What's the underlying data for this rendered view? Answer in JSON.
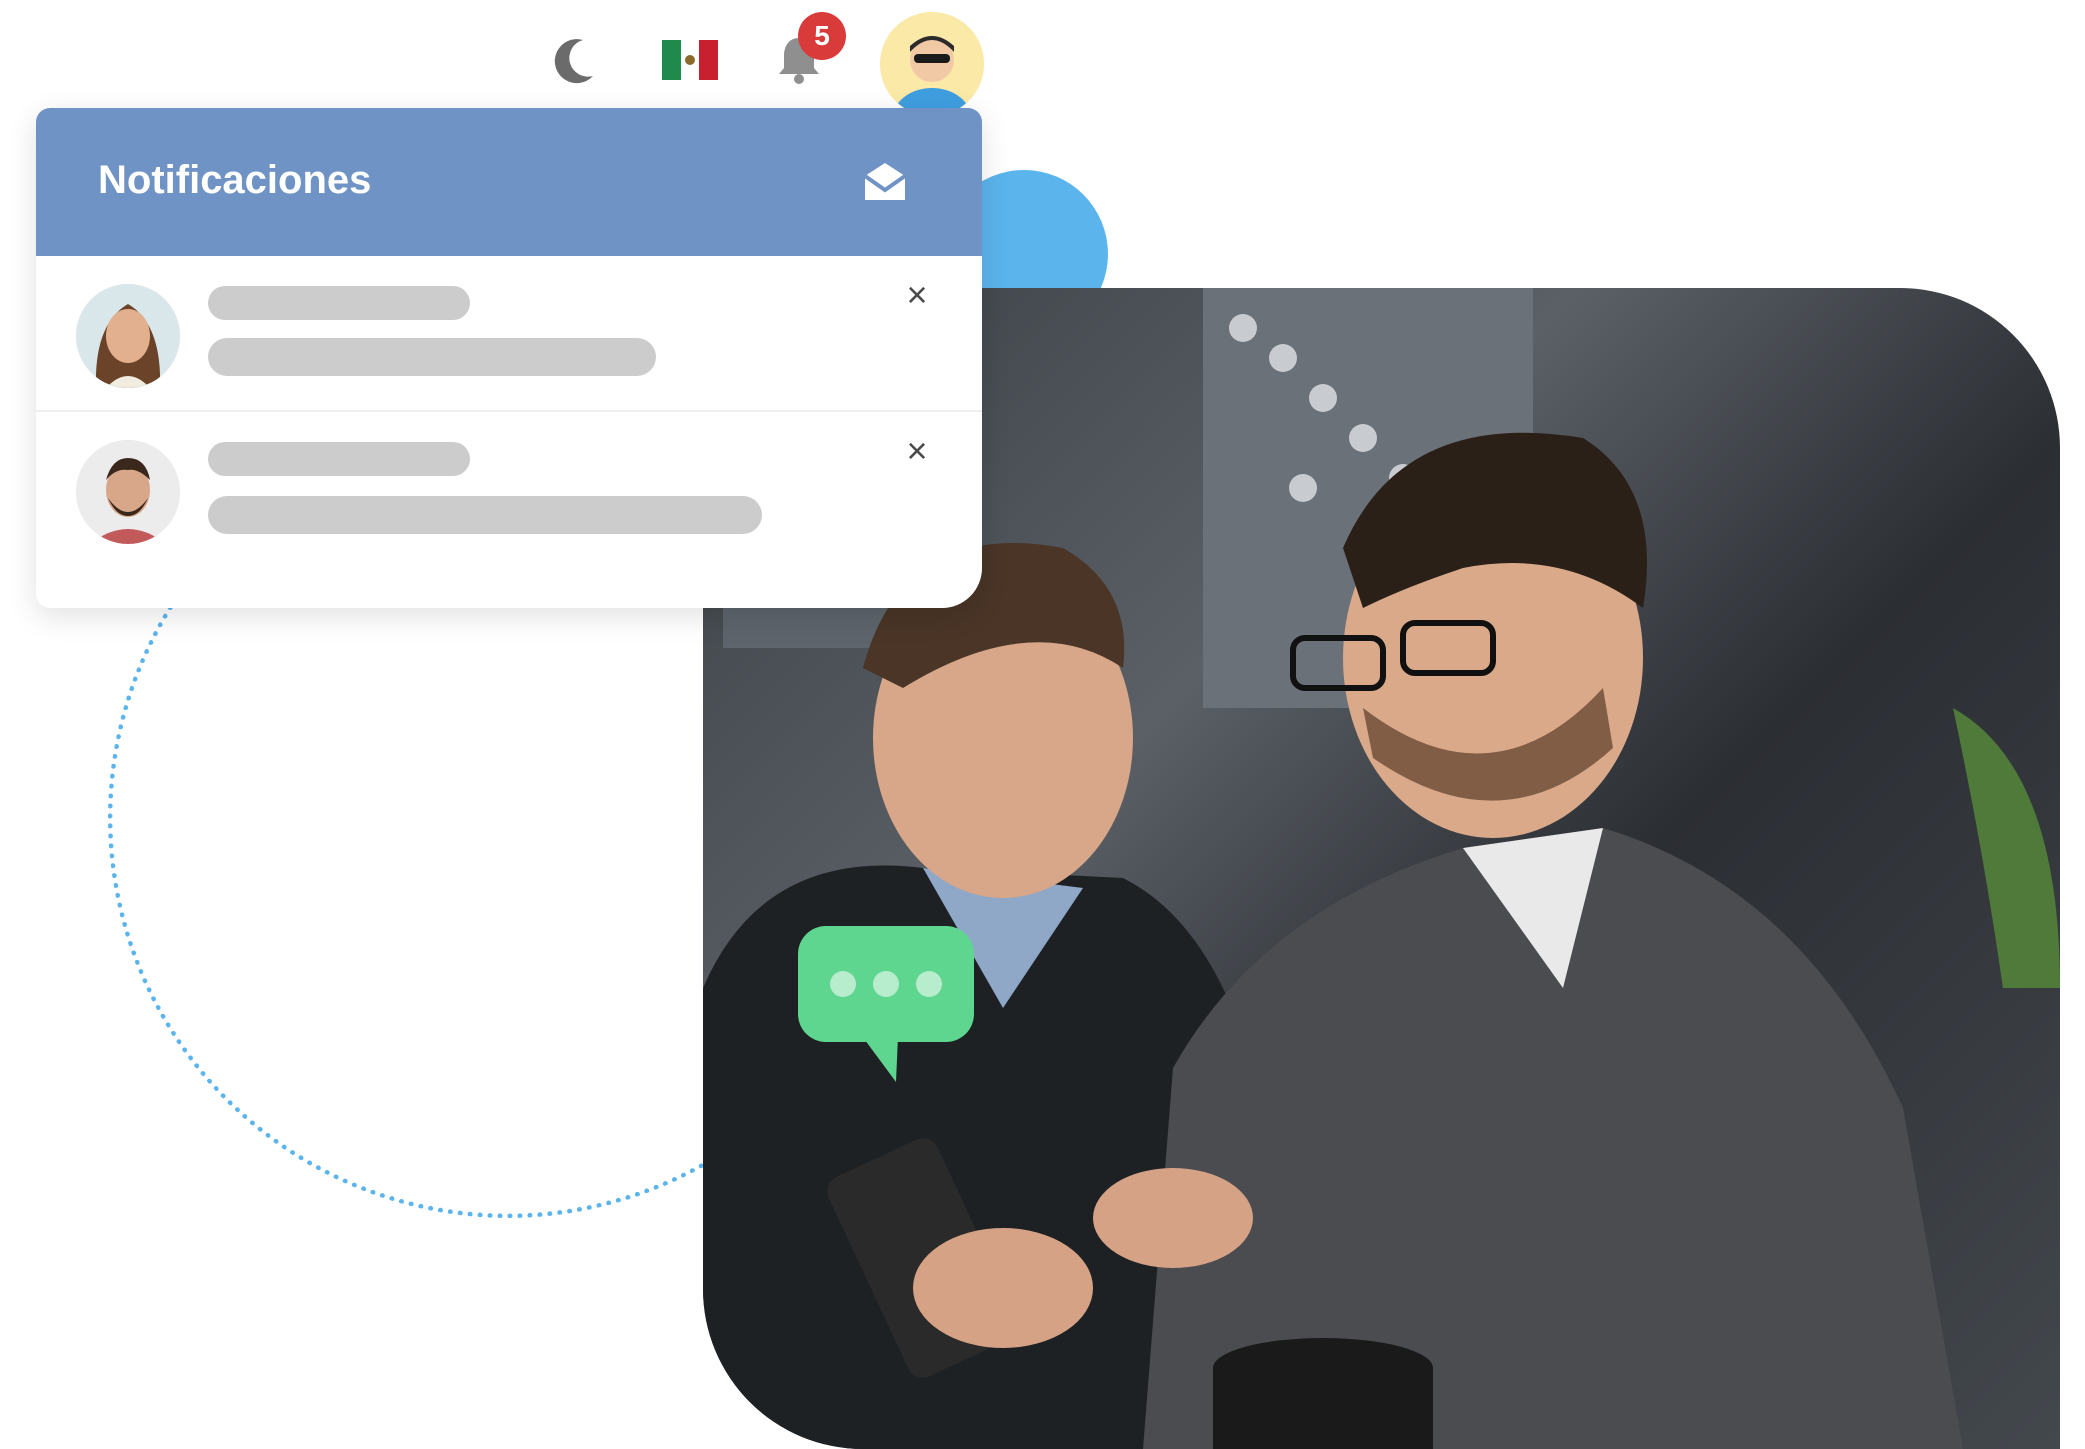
{
  "topbar": {
    "theme_icon": "moon-icon",
    "language_icon": "mexico-flag-icon",
    "notifications_icon": "bell-icon",
    "notification_count": "5",
    "user_avatar": "user-avatar"
  },
  "panel": {
    "title": "Notificaciones",
    "header_icon": "envelope-open-icon",
    "header_color": "#6f93c4",
    "items": [
      {
        "avatar": "woman-avatar",
        "close": "×"
      },
      {
        "avatar": "man-avatar",
        "close": "×"
      }
    ]
  },
  "colors": {
    "accent_blue": "#5bb4ec",
    "badge_red": "#d93a3a",
    "chat_green": "#5fd68f"
  }
}
